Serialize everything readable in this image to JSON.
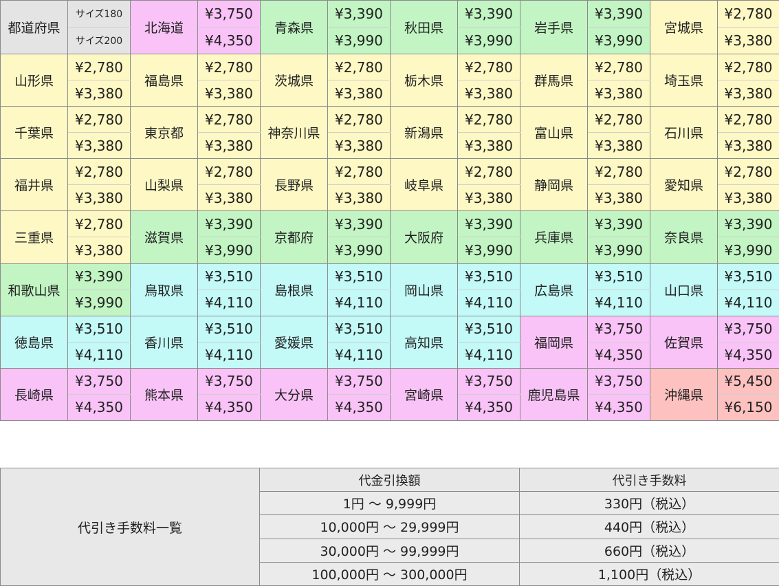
{
  "header": {
    "pref_label": "都道府県",
    "size1": "サイズ180",
    "size2": "サイズ200"
  },
  "zone_colors": {
    "pink": "#f9c3f7",
    "green": "#c2f5c3",
    "yellow": "#fdf8c4",
    "cyan": "#c3f9f7",
    "red": "#fdc1c0",
    "header_gray": "#e4e4e4"
  },
  "rows": [
    [
      {
        "name": "北海道",
        "p180": "¥3,750",
        "p200": "¥4,350",
        "zone": "pink"
      },
      {
        "name": "青森県",
        "p180": "¥3,390",
        "p200": "¥3,990",
        "zone": "green"
      },
      {
        "name": "秋田県",
        "p180": "¥3,390",
        "p200": "¥3,990",
        "zone": "green"
      },
      {
        "name": "岩手県",
        "p180": "¥3,390",
        "p200": "¥3,990",
        "zone": "green"
      },
      {
        "name": "宮城県",
        "p180": "¥2,780",
        "p200": "¥3,380",
        "zone": "yellow"
      }
    ],
    [
      {
        "name": "山形県",
        "p180": "¥2,780",
        "p200": "¥3,380",
        "zone": "yellow"
      },
      {
        "name": "福島県",
        "p180": "¥2,780",
        "p200": "¥3,380",
        "zone": "yellow"
      },
      {
        "name": "茨城県",
        "p180": "¥2,780",
        "p200": "¥3,380",
        "zone": "yellow"
      },
      {
        "name": "栃木県",
        "p180": "¥2,780",
        "p200": "¥3,380",
        "zone": "yellow"
      },
      {
        "name": "群馬県",
        "p180": "¥2,780",
        "p200": "¥3,380",
        "zone": "yellow"
      },
      {
        "name": "埼玉県",
        "p180": "¥2,780",
        "p200": "¥3,380",
        "zone": "yellow"
      }
    ],
    [
      {
        "name": "千葉県",
        "p180": "¥2,780",
        "p200": "¥3,380",
        "zone": "yellow"
      },
      {
        "name": "東京都",
        "p180": "¥2,780",
        "p200": "¥3,380",
        "zone": "yellow"
      },
      {
        "name": "神奈川県",
        "p180": "¥2,780",
        "p200": "¥3,380",
        "zone": "yellow"
      },
      {
        "name": "新潟県",
        "p180": "¥2,780",
        "p200": "¥3,380",
        "zone": "yellow"
      },
      {
        "name": "富山県",
        "p180": "¥2,780",
        "p200": "¥3,380",
        "zone": "yellow"
      },
      {
        "name": "石川県",
        "p180": "¥2,780",
        "p200": "¥3,380",
        "zone": "yellow"
      }
    ],
    [
      {
        "name": "福井県",
        "p180": "¥2,780",
        "p200": "¥3,380",
        "zone": "yellow"
      },
      {
        "name": "山梨県",
        "p180": "¥2,780",
        "p200": "¥3,380",
        "zone": "yellow"
      },
      {
        "name": "長野県",
        "p180": "¥2,780",
        "p200": "¥3,380",
        "zone": "yellow"
      },
      {
        "name": "岐阜県",
        "p180": "¥2,780",
        "p200": "¥3,380",
        "zone": "yellow"
      },
      {
        "name": "静岡県",
        "p180": "¥2,780",
        "p200": "¥3,380",
        "zone": "yellow"
      },
      {
        "name": "愛知県",
        "p180": "¥2,780",
        "p200": "¥3,380",
        "zone": "yellow"
      }
    ],
    [
      {
        "name": "三重県",
        "p180": "¥2,780",
        "p200": "¥3,380",
        "zone": "yellow"
      },
      {
        "name": "滋賀県",
        "p180": "¥3,390",
        "p200": "¥3,990",
        "zone": "green"
      },
      {
        "name": "京都府",
        "p180": "¥3,390",
        "p200": "¥3,990",
        "zone": "green"
      },
      {
        "name": "大阪府",
        "p180": "¥3,390",
        "p200": "¥3,990",
        "zone": "green"
      },
      {
        "name": "兵庫県",
        "p180": "¥3,390",
        "p200": "¥3,990",
        "zone": "green"
      },
      {
        "name": "奈良県",
        "p180": "¥3,390",
        "p200": "¥3,990",
        "zone": "green"
      }
    ],
    [
      {
        "name": "和歌山県",
        "p180": "¥3,390",
        "p200": "¥3,990",
        "zone": "green"
      },
      {
        "name": "鳥取県",
        "p180": "¥3,510",
        "p200": "¥4,110",
        "zone": "cyan"
      },
      {
        "name": "島根県",
        "p180": "¥3,510",
        "p200": "¥4,110",
        "zone": "cyan"
      },
      {
        "name": "岡山県",
        "p180": "¥3,510",
        "p200": "¥4,110",
        "zone": "cyan"
      },
      {
        "name": "広島県",
        "p180": "¥3,510",
        "p200": "¥4,110",
        "zone": "cyan"
      },
      {
        "name": "山口県",
        "p180": "¥3,510",
        "p200": "¥4,110",
        "zone": "cyan"
      }
    ],
    [
      {
        "name": "徳島県",
        "p180": "¥3,510",
        "p200": "¥4,110",
        "zone": "cyan"
      },
      {
        "name": "香川県",
        "p180": "¥3,510",
        "p200": "¥4,110",
        "zone": "cyan"
      },
      {
        "name": "愛媛県",
        "p180": "¥3,510",
        "p200": "¥4,110",
        "zone": "cyan"
      },
      {
        "name": "高知県",
        "p180": "¥3,510",
        "p200": "¥4,110",
        "zone": "cyan"
      },
      {
        "name": "福岡県",
        "p180": "¥3,750",
        "p200": "¥4,350",
        "zone": "pink"
      },
      {
        "name": "佐賀県",
        "p180": "¥3,750",
        "p200": "¥4,350",
        "zone": "pink"
      }
    ],
    [
      {
        "name": "長崎県",
        "p180": "¥3,750",
        "p200": "¥4,350",
        "zone": "pink"
      },
      {
        "name": "熊本県",
        "p180": "¥3,750",
        "p200": "¥4,350",
        "zone": "pink"
      },
      {
        "name": "大分県",
        "p180": "¥3,750",
        "p200": "¥4,350",
        "zone": "pink"
      },
      {
        "name": "宮崎県",
        "p180": "¥3,750",
        "p200": "¥4,350",
        "zone": "pink"
      },
      {
        "name": "鹿児島県",
        "p180": "¥3,750",
        "p200": "¥4,350",
        "zone": "pink"
      },
      {
        "name": "沖縄県",
        "p180": "¥5,450",
        "p200": "¥6,150",
        "zone": "red"
      }
    ]
  ],
  "cod": {
    "title": "代引き手数料一覧",
    "col_amount": "代金引換額",
    "col_fee": "代引き手数料",
    "rows": [
      {
        "range": "1円 〜 9,999円",
        "fee": "330円（税込）"
      },
      {
        "range": "10,000円 〜 29,999円",
        "fee": "440円（税込）"
      },
      {
        "range": "30,000円 〜 99,999円",
        "fee": "660円（税込）"
      },
      {
        "range": "100,000円 〜 300,000円",
        "fee": "1,100円（税込）"
      }
    ]
  }
}
